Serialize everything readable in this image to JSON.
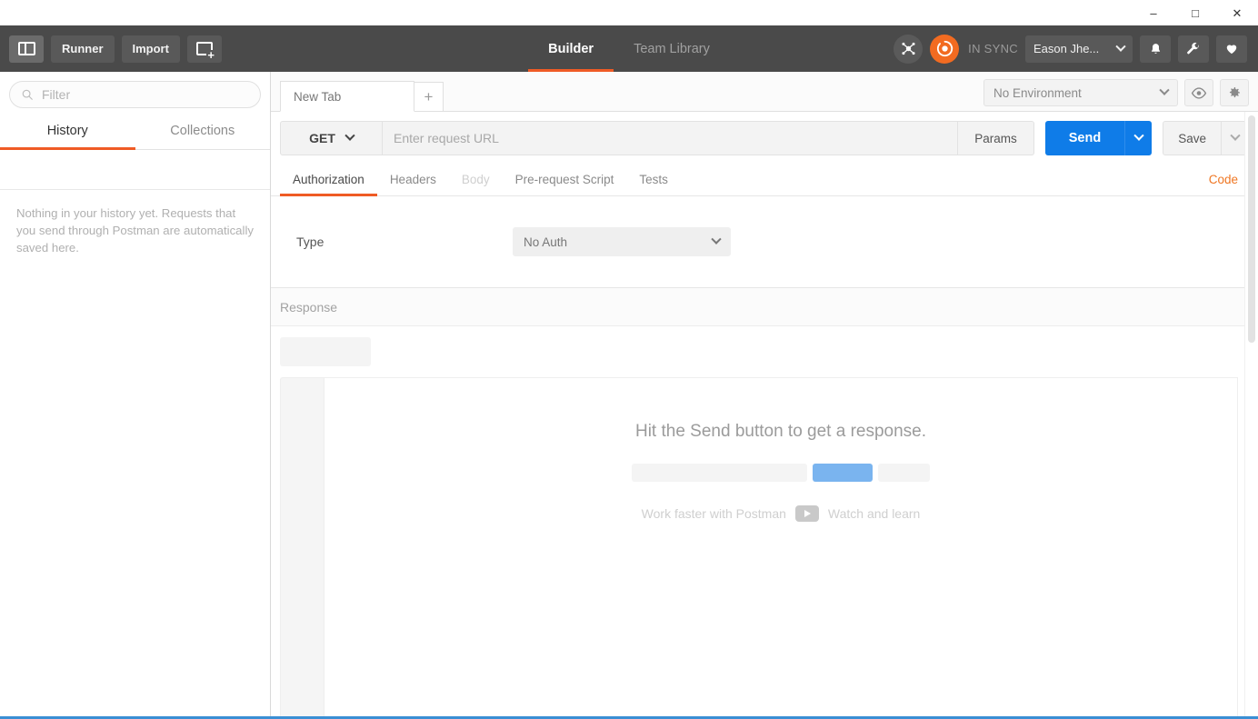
{
  "window": {
    "minimize_label": "–",
    "maximize_label": "□",
    "close_label": "✕"
  },
  "appbar": {
    "sidebar_toggle_name": "sidebar-toggle",
    "runner_label": "Runner",
    "import_label": "Import",
    "new_window_label": "",
    "nav_tabs": [
      {
        "label": "Builder",
        "active": true
      },
      {
        "label": "Team Library",
        "active": false
      }
    ],
    "sync_status": "IN SYNC",
    "user_name": "Eason Jhe...",
    "notifications_icon": "bell-icon",
    "settings_wrench_icon": "wrench-icon",
    "heart_icon": "heart-icon"
  },
  "sidebar": {
    "filter_placeholder": "Filter",
    "filter_value": "",
    "tabs": [
      {
        "label": "History",
        "active": true
      },
      {
        "label": "Collections",
        "active": false
      }
    ],
    "empty_message": "Nothing in your history yet. Requests that you send through Postman are automatically saved here."
  },
  "tabs": {
    "items": [
      {
        "label": "New Tab",
        "active": true
      }
    ],
    "add_label": "+"
  },
  "environment": {
    "selected": "No Environment",
    "eye_icon": "eye-icon",
    "gear_icon": "gear-icon"
  },
  "request": {
    "method": "GET",
    "url_value": "",
    "url_placeholder": "Enter request URL",
    "params_label": "Params",
    "send_label": "Send",
    "save_label": "Save",
    "code_label": "Code",
    "tabs": [
      {
        "label": "Authorization",
        "active": true,
        "disabled": false
      },
      {
        "label": "Headers",
        "active": false,
        "disabled": false
      },
      {
        "label": "Body",
        "active": false,
        "disabled": true
      },
      {
        "label": "Pre-request Script",
        "active": false,
        "disabled": false
      },
      {
        "label": "Tests",
        "active": false,
        "disabled": false
      }
    ]
  },
  "authorization": {
    "type_label": "Type",
    "type_value": "No Auth"
  },
  "response": {
    "header_label": "Response",
    "empty_title": "Hit the Send button to get a response.",
    "learn_prefix": "Work faster with Postman",
    "learn_suffix": "Watch and learn",
    "play_icon": "play-icon"
  },
  "colors": {
    "accent_orange": "#ef5b25",
    "send_blue": "#0f7ce8",
    "header_dark": "#4a4a4a",
    "sync_orange": "#f26b21",
    "window_border_blue": "#3a8fd4"
  }
}
